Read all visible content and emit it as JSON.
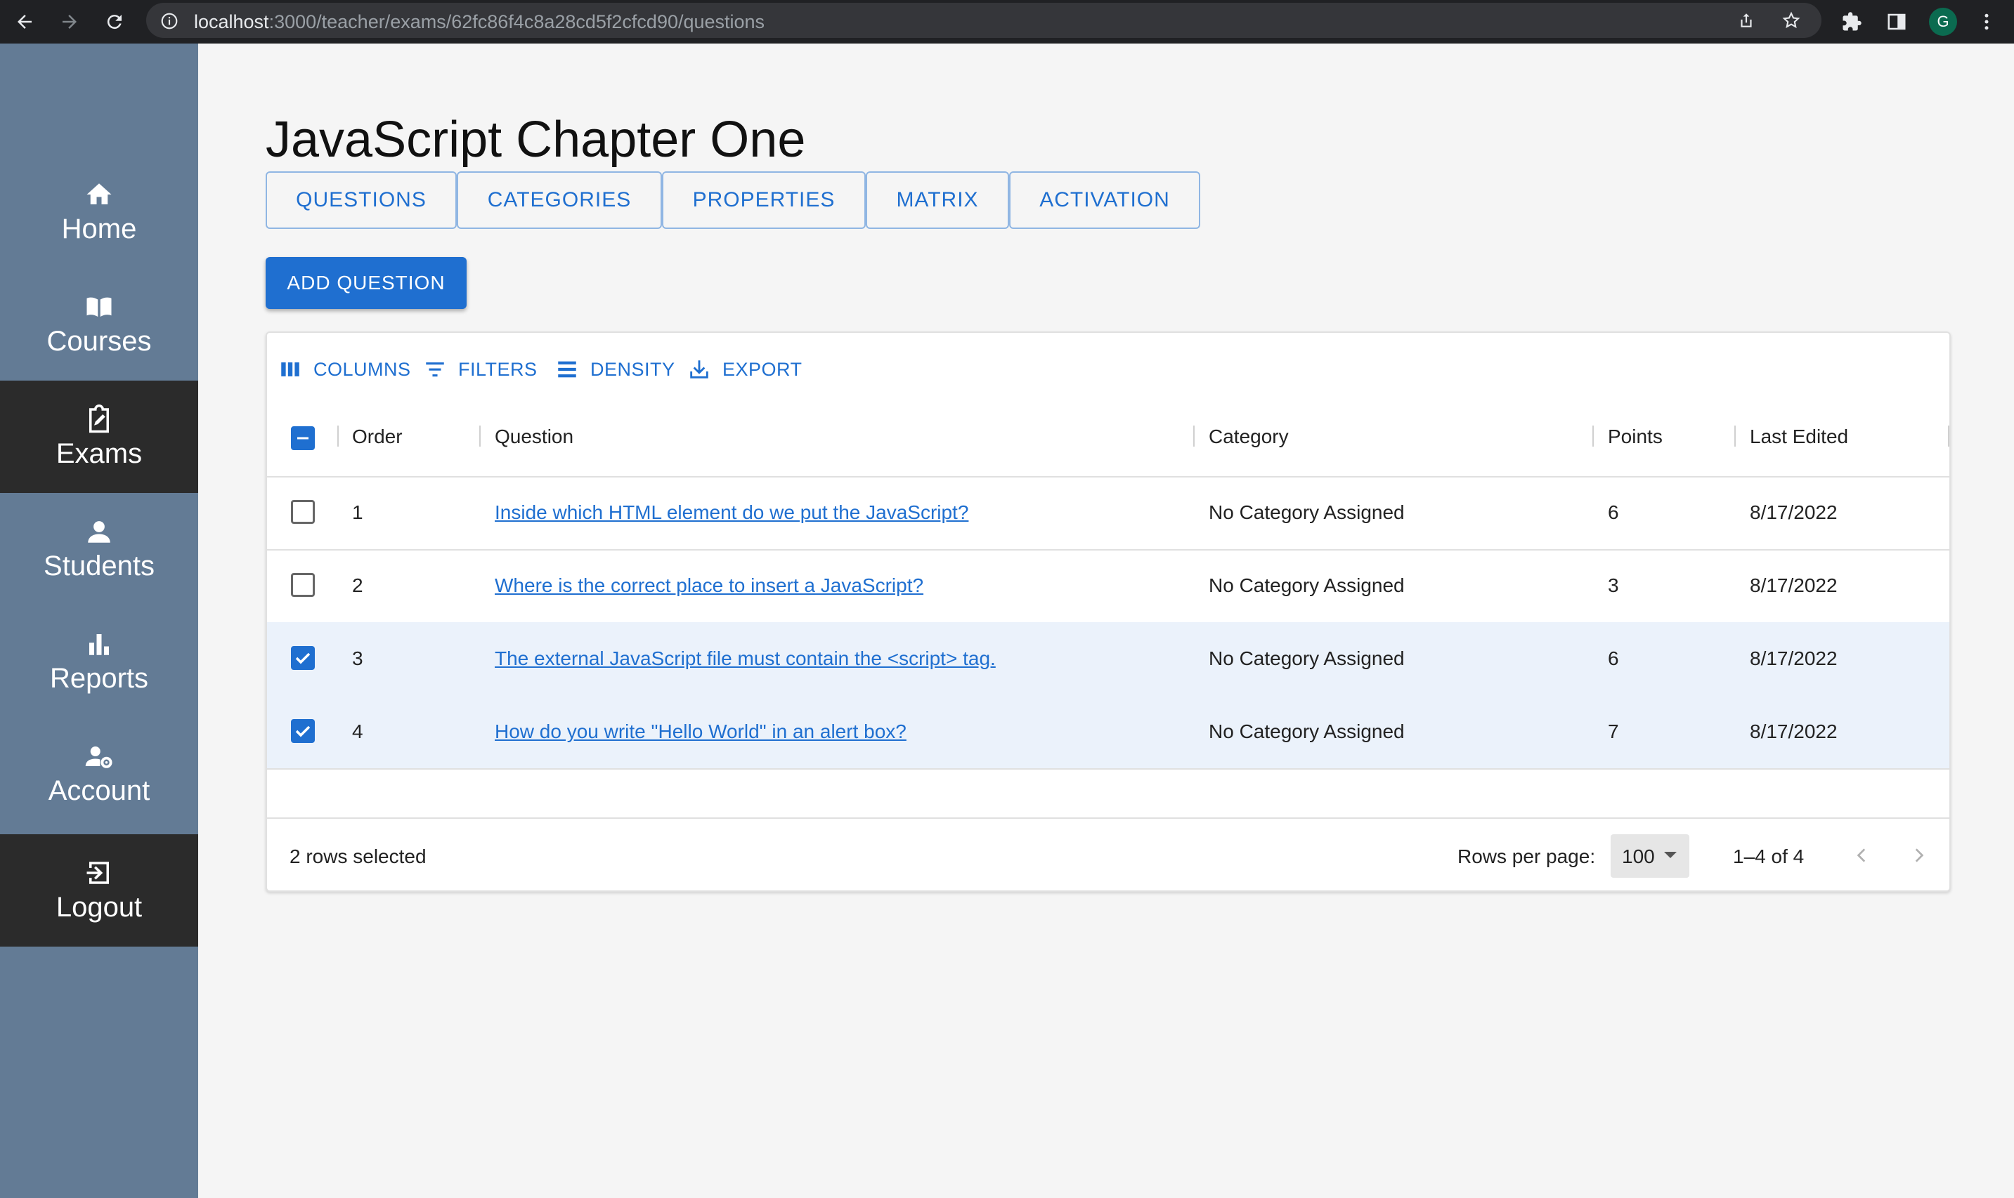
{
  "browser": {
    "url_host": "localhost",
    "url_path": ":3000/teacher/exams/62fc86f4c8a28cd5f2cfcd90/questions",
    "profile_initial": "G"
  },
  "sidebar": {
    "items": [
      {
        "label": "Home",
        "icon": "home-icon"
      },
      {
        "label": "Courses",
        "icon": "book-icon"
      },
      {
        "label": "Exams",
        "icon": "clipboard-edit-icon",
        "active": true
      },
      {
        "label": "Students",
        "icon": "person-icon"
      },
      {
        "label": "Reports",
        "icon": "bar-chart-icon"
      },
      {
        "label": "Account",
        "icon": "user-gear-icon"
      },
      {
        "label": "Logout",
        "icon": "logout-icon"
      }
    ]
  },
  "page": {
    "title": "JavaScript Chapter One",
    "tabs": [
      "QUESTIONS",
      "CATEGORIES",
      "PROPERTIES",
      "MATRIX",
      "ACTIVATION"
    ],
    "add_button": "ADD QUESTION"
  },
  "grid": {
    "toolbar": [
      "COLUMNS",
      "FILTERS",
      "DENSITY",
      "EXPORT"
    ],
    "columns": [
      "Order",
      "Question",
      "Category",
      "Points",
      "Last Edited"
    ],
    "rows": [
      {
        "order": "1",
        "question": "Inside which HTML element do we put the JavaScript?",
        "category": "No Category Assigned",
        "points": "6",
        "edited": "8/17/2022",
        "selected": false
      },
      {
        "order": "2",
        "question": "Where is the correct place to insert a JavaScript?",
        "category": "No Category Assigned",
        "points": "3",
        "edited": "8/17/2022",
        "selected": false
      },
      {
        "order": "3",
        "question": "The external JavaScript file must contain the <script> tag.",
        "category": "No Category Assigned",
        "points": "6",
        "edited": "8/17/2022",
        "selected": true
      },
      {
        "order": "4",
        "question": "How do you write \"Hello World\" in an alert box?",
        "category": "No Category Assigned",
        "points": "7",
        "edited": "8/17/2022",
        "selected": true
      }
    ],
    "footer": {
      "selection": "2 rows selected",
      "rows_per_page_label": "Rows per page:",
      "rows_per_page_value": "100",
      "range": "1–4 of 4"
    }
  },
  "colors": {
    "sidebar": "#637b95",
    "active_nav": "#2b2b2b",
    "accent": "#1f6fd0"
  }
}
